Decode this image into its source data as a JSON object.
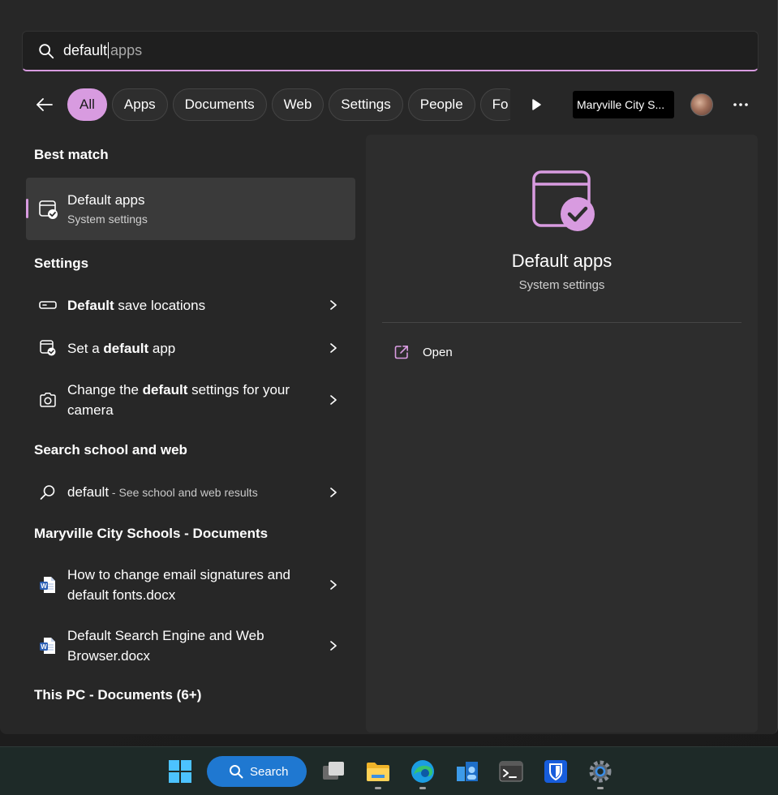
{
  "search": {
    "typed": "default",
    "suggestion": "apps"
  },
  "filters": {
    "chips": [
      "All",
      "Apps",
      "Documents",
      "Web",
      "Settings",
      "People",
      "Fo"
    ],
    "active": "All",
    "org": "Maryville City S..."
  },
  "sections": {
    "best_match": "Best match",
    "settings": "Settings",
    "search_web": "Search school and web",
    "school_docs": "Maryville City Schools - Documents",
    "this_pc": "This PC - Documents (6+)"
  },
  "best_match": {
    "title": "Default apps",
    "subtitle": "System settings"
  },
  "settings_items": [
    {
      "bold": "Default",
      "rest": " save locations",
      "icon": "storage-icon"
    },
    {
      "pre": "Set a ",
      "bold": "default",
      "rest": " app",
      "icon": "default-apps-icon"
    },
    {
      "pre": "Change the ",
      "bold": "default",
      "rest": " settings for your camera",
      "icon": "camera-icon"
    }
  ],
  "web_result": {
    "term": "default",
    "hint": " - See school and web results"
  },
  "documents": [
    {
      "title": "How to change email signatures and default fonts.docx",
      "icon": "word-doc-icon"
    },
    {
      "title": "Default Search Engine and Web Browser.docx",
      "icon": "word-doc-icon"
    }
  ],
  "preview": {
    "title": "Default apps",
    "subtitle": "System settings",
    "action": "Open"
  },
  "taskbar": {
    "search_label": "Search"
  },
  "colors": {
    "accent": "#d89be0",
    "panel": "#272727",
    "taskbar_search": "#1f78d1"
  }
}
